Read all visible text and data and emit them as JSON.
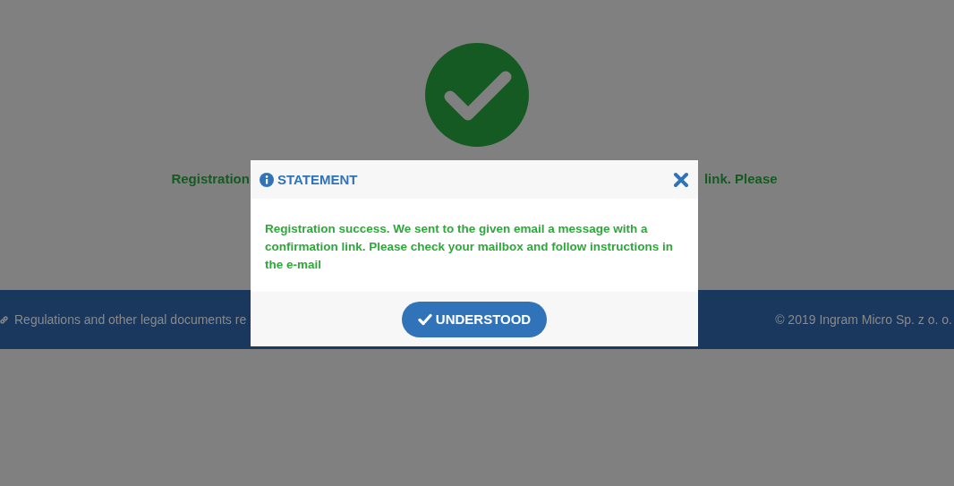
{
  "page": {
    "message_left": "Registration",
    "message_right": "link. Please"
  },
  "footer": {
    "link": "Regulations and other legal documents re",
    "copyright": "© 2019 Ingram Micro Sp. z o. o."
  },
  "dialog": {
    "title": "STATEMENT",
    "message": "Registration success. We sent to the given email a message with a confirmation link. Please check your mailbox and follow instructions in the e-mail",
    "button": "UNDERSTOOD"
  }
}
